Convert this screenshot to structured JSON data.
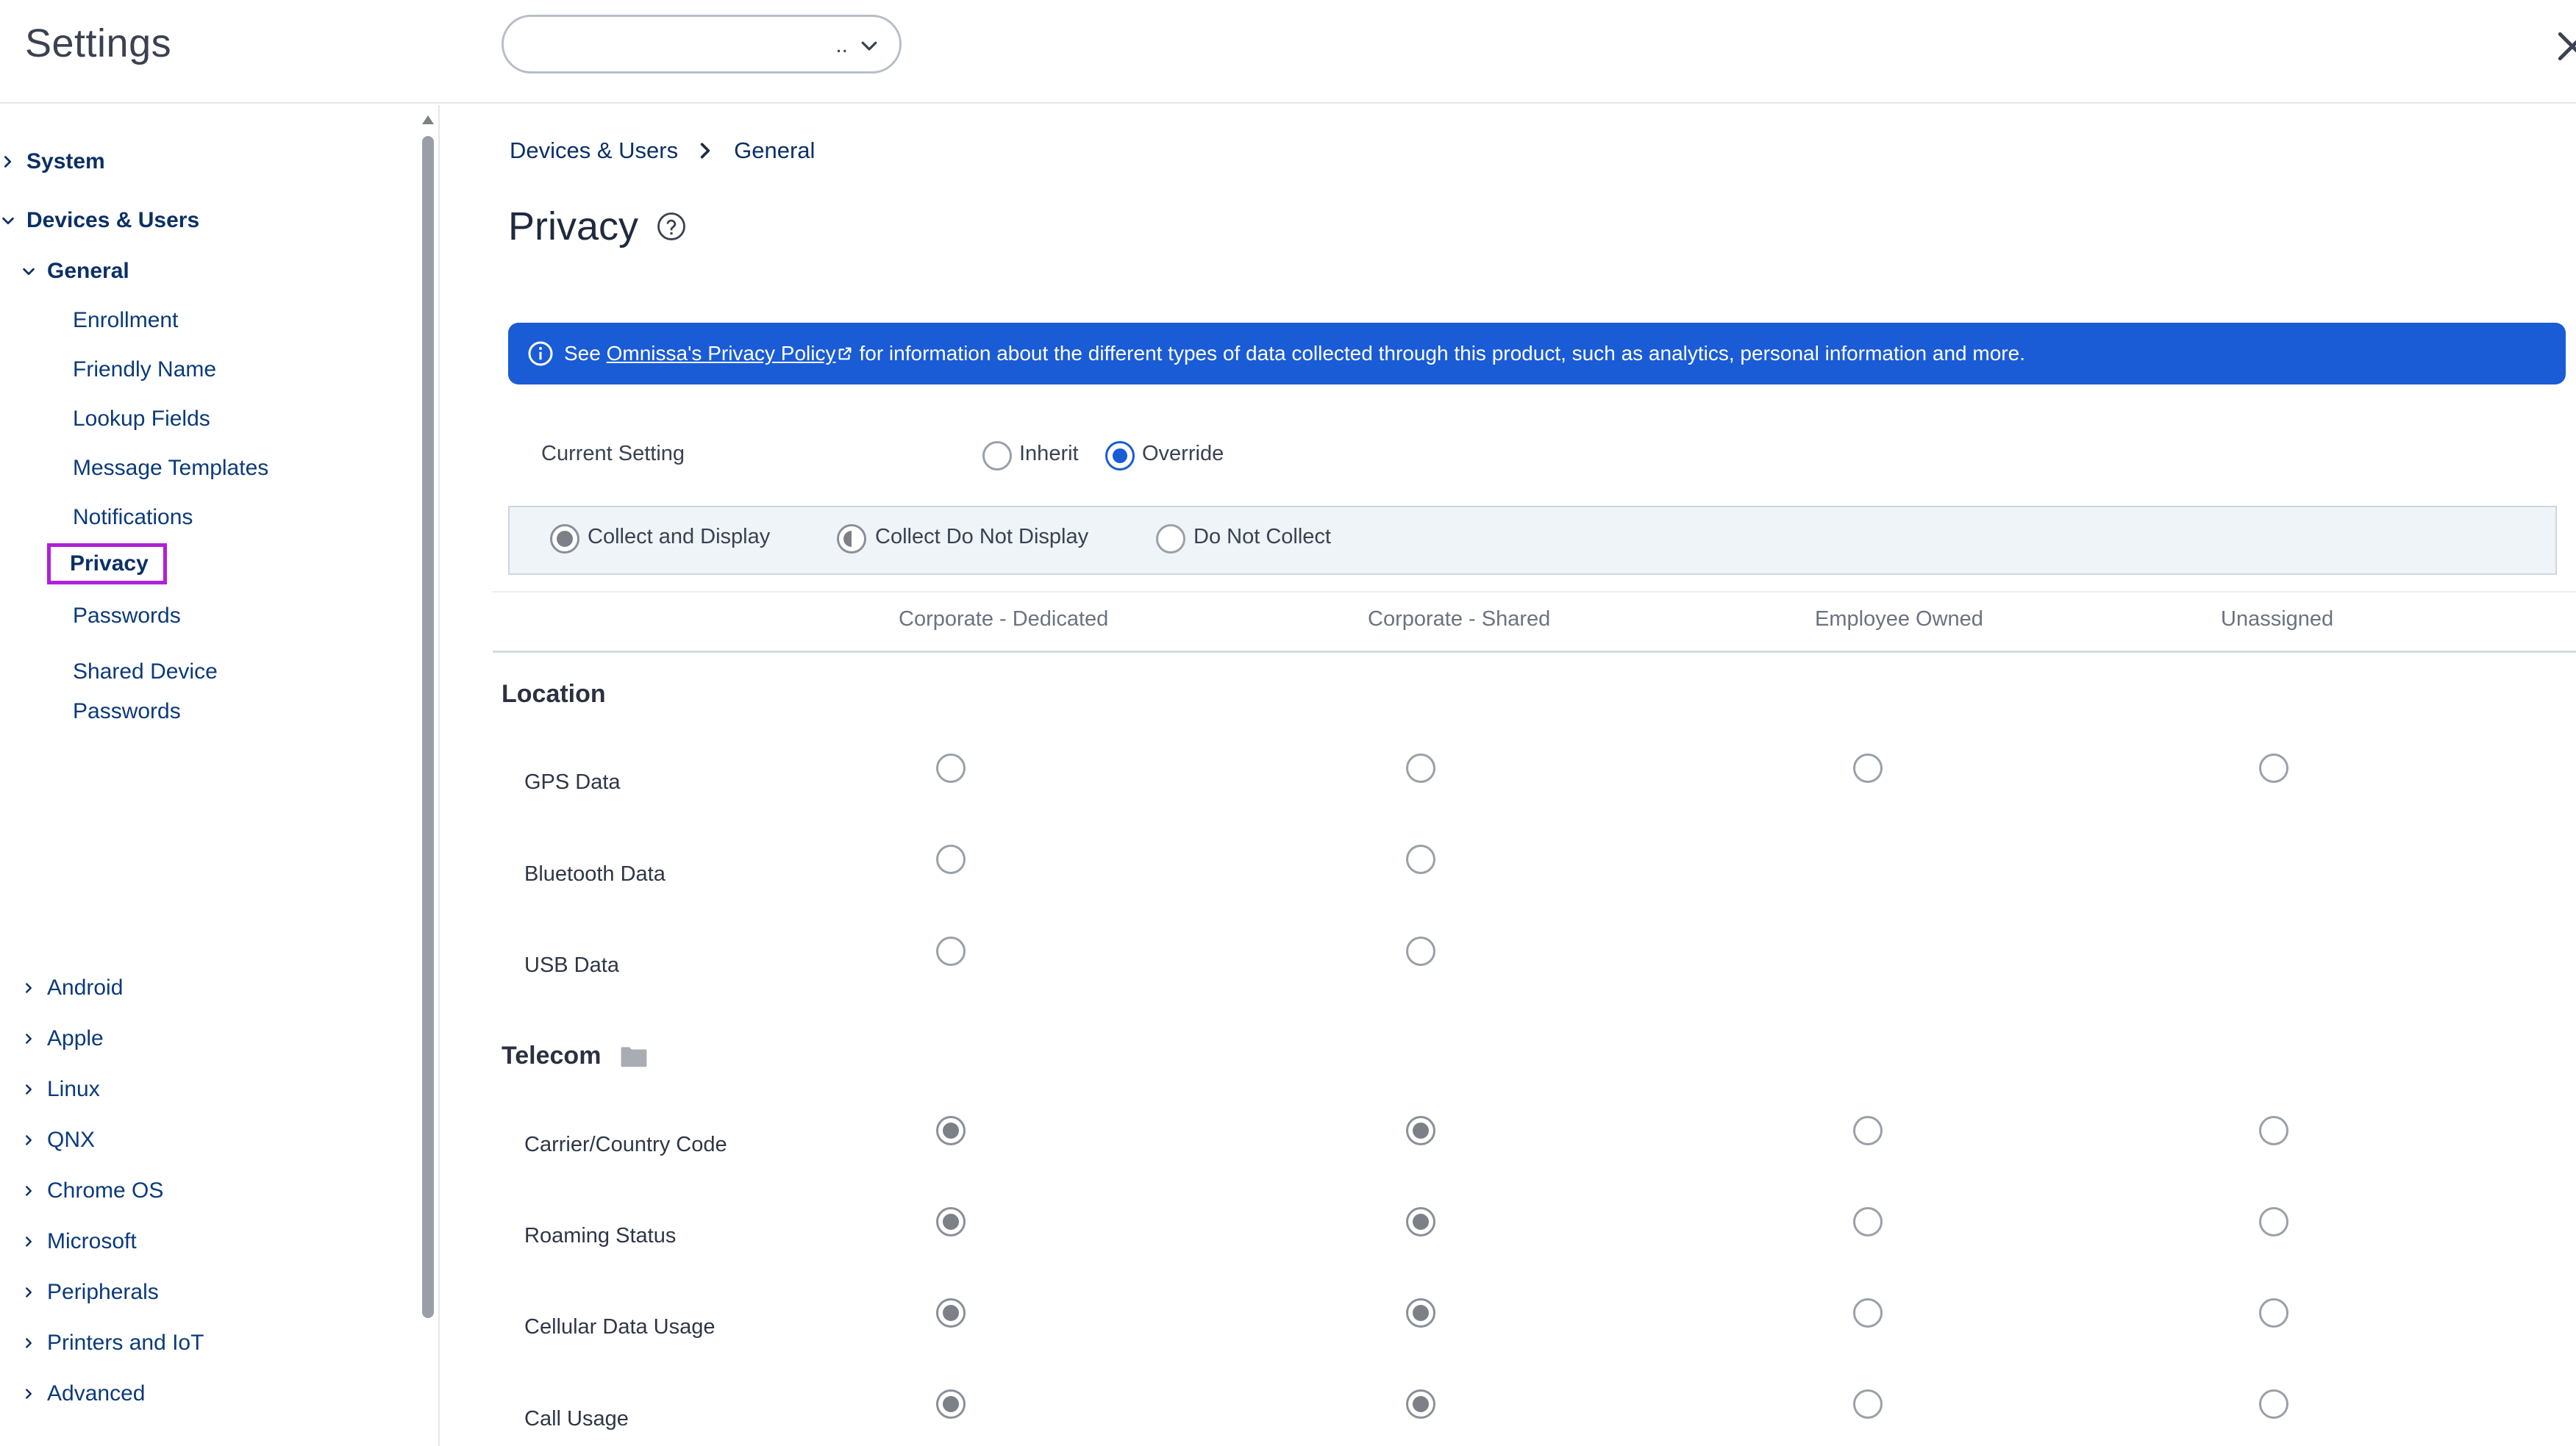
{
  "app": {
    "title": "Settings"
  },
  "header": {
    "select_value": ".."
  },
  "sidebar": {
    "system": "System",
    "devices_users": "Devices & Users",
    "general": "General",
    "general_items": [
      "Enrollment",
      "Friendly Name",
      "Lookup Fields",
      "Message Templates",
      "Notifications",
      "Privacy",
      "Passwords",
      "Shared Device",
      "Passwords"
    ],
    "platform_items": [
      "Android",
      "Apple",
      "Linux",
      "QNX",
      "Chrome OS",
      "Microsoft",
      "Peripherals",
      "Printers and IoT",
      "Advanced"
    ]
  },
  "breadcrumb": {
    "part1": "Devices & Users",
    "part2": "General"
  },
  "page": {
    "title": "Privacy"
  },
  "banner": {
    "prefix": "See ",
    "link": "Omnissa's Privacy Policy",
    "suffix": " for information about the different types of data collected through this product, such as analytics, personal information and more."
  },
  "current_setting": {
    "label": "Current Setting",
    "inherit": "Inherit",
    "override": "Override",
    "selected": "Override"
  },
  "legend": {
    "collect_display": "Collect and Display",
    "collect_no_display": "Collect Do Not Display",
    "do_not_collect": "Do Not Collect"
  },
  "columns": [
    "Corporate - Dedicated",
    "Corporate - Shared",
    "Employee Owned",
    "Unassigned"
  ],
  "sections": {
    "location": {
      "title": "Location",
      "rows": [
        {
          "label": "GPS Data",
          "values": [
            "none",
            "none",
            "none",
            "none"
          ]
        },
        {
          "label": "Bluetooth Data",
          "values": [
            "none",
            "none",
            null,
            null
          ]
        },
        {
          "label": "USB Data",
          "values": [
            "none",
            "none",
            null,
            null
          ]
        }
      ]
    },
    "telecom": {
      "title": "Telecom",
      "icon": "folder-icon",
      "rows": [
        {
          "label": "Carrier/Country Code",
          "values": [
            "collect_display",
            "collect_display",
            "none",
            "none"
          ]
        },
        {
          "label": "Roaming Status",
          "values": [
            "collect_display",
            "collect_display",
            "none",
            "none"
          ]
        },
        {
          "label": "Cellular Data Usage",
          "values": [
            "collect_display",
            "collect_display",
            "none",
            "none"
          ]
        },
        {
          "label": "Call Usage",
          "values": [
            "collect_display",
            "collect_display",
            "none",
            "none"
          ]
        }
      ]
    }
  },
  "colors": {
    "accent": "#1a5bd6",
    "nav_text": "#0b3066",
    "active_outline": "#b020d8",
    "filled_radio": "#7c8087"
  }
}
